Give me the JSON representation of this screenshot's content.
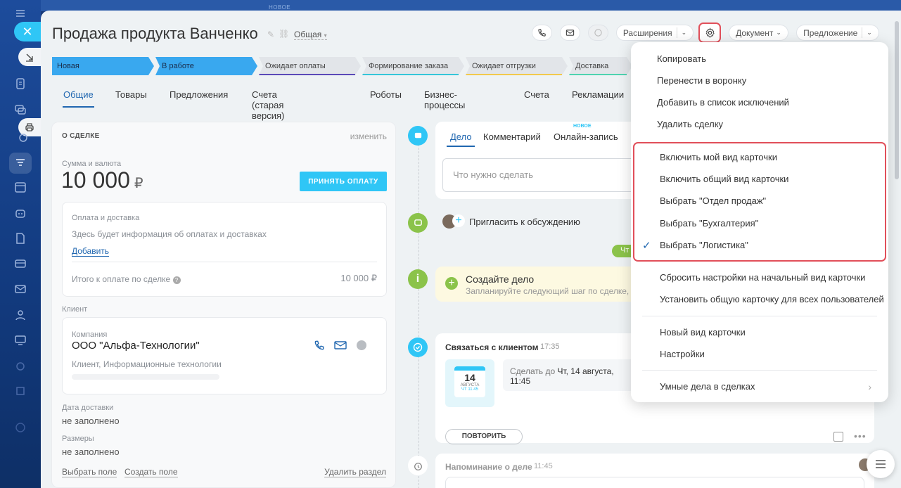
{
  "window": {
    "new_tag": "НОВОЕ"
  },
  "header": {
    "title": "Продажа продукта Ванченко",
    "category": "Общая",
    "extensions": "Расширения",
    "document": "Документ",
    "offer": "Предложение"
  },
  "stages": [
    {
      "label": "Новая",
      "state": "active",
      "color": "#39a8ef"
    },
    {
      "label": "В работе",
      "state": "active",
      "color": "#39a8ef"
    },
    {
      "label": "Ожидает оплаты",
      "state": "idle",
      "color": "#5a4ab8"
    },
    {
      "label": "Формирование заказа",
      "state": "idle",
      "color": "#35c6d9"
    },
    {
      "label": "Ожидает отгрузки",
      "state": "idle",
      "color": "#f2c94c"
    },
    {
      "label": "Доставка",
      "state": "idle",
      "color": "#4fd3b0"
    }
  ],
  "tabs": [
    "Общие",
    "Товары",
    "Предложения",
    "Счета (старая версия)",
    "Роботы",
    "Бизнес-процессы",
    "Счета",
    "Рекламации"
  ],
  "about": {
    "title": "О СДЕЛКЕ",
    "change": "изменить",
    "sum_label": "Сумма и валюта",
    "sum_value": "10 000",
    "currency": "₽",
    "pay_button": "ПРИНЯТЬ ОПЛАТУ",
    "payment_title": "Оплата и доставка",
    "payment_info": "Здесь будет информация об оплатах и доставках",
    "add_link": "Добавить",
    "total_label": "Итого к оплате по сделке",
    "total_value": "10 000 ₽",
    "client_label": "Клиент",
    "company_label": "Компания",
    "company_name": "ООО \"Альфа-Технологии\"",
    "company_desc": "Клиент, Информационные технологии",
    "delivery_label": "Дата доставки",
    "delivery_value": "не заполнено",
    "size_label": "Размеры",
    "size_value": "не заполнено",
    "select_field": "Выбрать поле",
    "create_field": "Создать поле",
    "delete_section": "Удалить раздел"
  },
  "timeline": {
    "tab_deal": "Дело",
    "tab_comment": "Комментарий",
    "tab_online": "Онлайн-запись",
    "tab_online_tag": "НОВОЕ",
    "input_placeholder": "Что нужно сделать",
    "invite": "Пригласить к обсуждению",
    "pill": "Чт",
    "create_title": "Создайте дело",
    "create_sub": "Запланируйте следующий шаг по сделке, ч",
    "task_title": "Связаться с клиентом",
    "task_time": "17:35",
    "due_prefix": "Сделать до",
    "due_value": "Чт, 14 августа, 11:45",
    "cal_day": "14",
    "cal_month": "АВГУСТА",
    "cal_sub": "ЧТ 11:45",
    "repeat": "ПОВТОРИТЬ",
    "reminder_title": "Напоминание о деле",
    "reminder_time": "11:45"
  },
  "menu": {
    "items_top": [
      "Копировать",
      "Перенести в воронку",
      "Добавить в список исключений",
      "Удалить сделку"
    ],
    "items_view": [
      "Включить мой вид карточки",
      "Включить общий вид карточки",
      "Выбрать \"Отдел продаж\"",
      "Выбрать \"Бухгалтерия\"",
      "Выбрать \"Логистика\""
    ],
    "items_reset": [
      "Сбросить настройки на начальный вид карточки",
      "Установить общую карточку для всех пользователей"
    ],
    "items_new": [
      "Новый вид карточки",
      "Настройки"
    ],
    "smart": "Умные дела в сделках"
  }
}
